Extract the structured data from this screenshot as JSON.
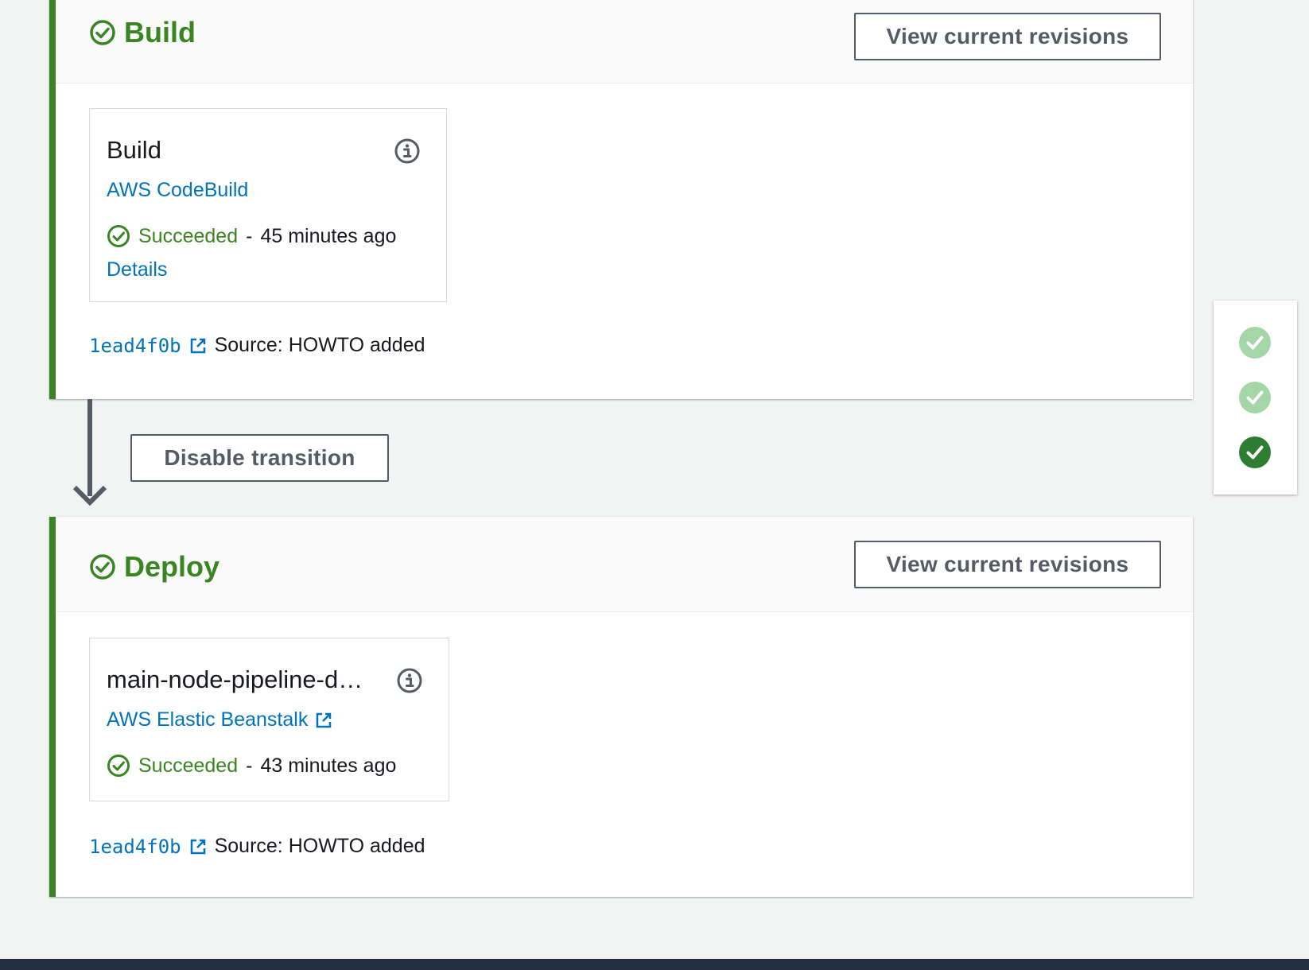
{
  "colors": {
    "success": "#3b8422",
    "link": "#0073bb",
    "button_border": "#545b64",
    "background": "#f2f3f3",
    "footer": "#232f3e",
    "minimap_light": "#a5d6a7",
    "minimap_dark": "#2e7d32"
  },
  "stages": {
    "build": {
      "title": "Build",
      "status_icon": "check-circle-icon",
      "view_revisions_label": "View current revisions",
      "action": {
        "name": "Build",
        "provider": "AWS CodeBuild",
        "provider_external": false,
        "status": "Succeeded",
        "separator": "-",
        "time": "45 minutes ago",
        "details_label": "Details"
      },
      "revision": {
        "commit": "1ead4f0b",
        "summary": "Source: HOWTO added"
      }
    },
    "deploy": {
      "title": "Deploy",
      "status_icon": "check-circle-icon",
      "view_revisions_label": "View current revisions",
      "action": {
        "name": "main-node-pipeline-d…",
        "provider": "AWS Elastic Beanstalk",
        "provider_external": true,
        "status": "Succeeded",
        "separator": "-",
        "time": "43 minutes ago"
      },
      "revision": {
        "commit": "1ead4f0b",
        "summary": "Source: HOWTO added"
      }
    }
  },
  "transition": {
    "disable_label": "Disable transition"
  },
  "minimap": {
    "items": [
      {
        "icon": "check-icon",
        "state": "completed"
      },
      {
        "icon": "check-icon",
        "state": "completed"
      },
      {
        "icon": "check-icon",
        "state": "current"
      }
    ]
  }
}
